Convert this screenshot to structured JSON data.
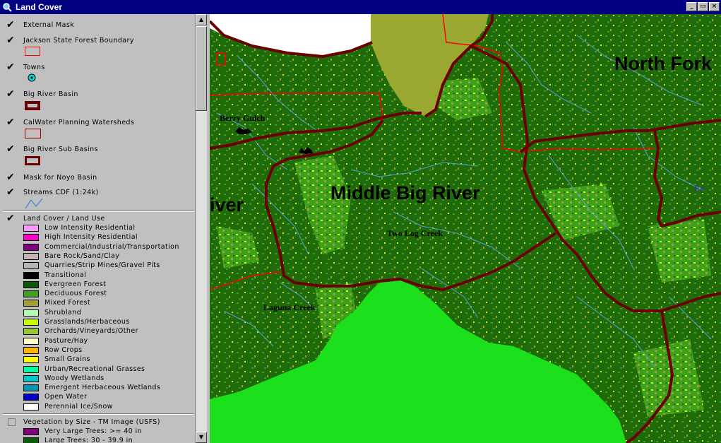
{
  "window": {
    "title": "Land Cover",
    "minimize": "_",
    "restore": "▭",
    "close": "×"
  },
  "toc": {
    "layers": [
      {
        "name": "External Mask",
        "checked": "✔"
      },
      {
        "name": "Jackson State Forest Boundary",
        "checked": "✔"
      },
      {
        "name": "Towns",
        "checked": "✔"
      },
      {
        "name": "Big River Basin",
        "checked": "✔"
      },
      {
        "name": "CalWater Planning Watersheds",
        "checked": "✔"
      },
      {
        "name": "Big River Sub Basins",
        "checked": "✔"
      },
      {
        "name": "Mask for Noyo Basin",
        "checked": "✔"
      },
      {
        "name": "Streams CDF (1:24k)",
        "checked": "✔"
      },
      {
        "name": "Land Cover / Land Use",
        "checked": "✔"
      },
      {
        "name": "Vegetation by Size - TM Image (USFS)",
        "checked": ""
      }
    ],
    "land_cover_legend": [
      {
        "label": "Low Intensity Residential",
        "color": "#ff99ff"
      },
      {
        "label": "High Intensity Residential",
        "color": "#ff00cc"
      },
      {
        "label": "Commercial/Industrial/Transportation",
        "color": "#800080"
      },
      {
        "label": "Bare Rock/Sand/Clay",
        "color": "#c8b4b4"
      },
      {
        "label": "Quarries/Strip Mines/Gravel Pits",
        "color": "#b4b4b4"
      },
      {
        "label": "Transitional",
        "color": "#000000"
      },
      {
        "label": "Evergreen Forest",
        "color": "#0a5a0a"
      },
      {
        "label": "Deciduous Forest",
        "color": "#3ca01e"
      },
      {
        "label": "Mixed Forest",
        "color": "#a0a032"
      },
      {
        "label": "Shrubland",
        "color": "#b4ffb4"
      },
      {
        "label": "Grasslands/Herbaceous",
        "color": "#c8ff00"
      },
      {
        "label": "Orchards/Vineyards/Other",
        "color": "#96c832"
      },
      {
        "label": "Pasture/Hay",
        "color": "#ffffc8"
      },
      {
        "label": "Row Crops",
        "color": "#ffb400"
      },
      {
        "label": "Small Grains",
        "color": "#ffff00"
      },
      {
        "label": "Urban/Recreational Grasses",
        "color": "#00ffa0"
      },
      {
        "label": "Woody Wetlands",
        "color": "#00c8c8"
      },
      {
        "label": "Emergent Herbaceous Wetlands",
        "color": "#0096b4"
      },
      {
        "label": "Open Water",
        "color": "#0000c8"
      },
      {
        "label": "Perennial Ice/Snow",
        "color": "#ffffff"
      }
    ],
    "vegetation_legend": [
      {
        "label": "Very Large Trees: >= 40  in",
        "color": "#800080"
      },
      {
        "label": "Large Trees: 30 - 39.9 in",
        "color": "#0a5a0a"
      }
    ]
  },
  "map": {
    "labels": {
      "north_fork": "North Fork",
      "middle_big_river": "Middle Big River",
      "river_fragment": "iver",
      "berry_gulch": "Berry Gulch",
      "two_log_creek": "Two Log Creek",
      "laguna_creek": "Laguna Creek",
      "east_fragment": "Ea"
    },
    "colors": {
      "evergreen": "#1f6b0b",
      "deciduous": "#3ca01e",
      "mixed": "#a0a032",
      "grassland": "#c8ff00",
      "mask": "#9aa832",
      "bright_mask": "#1de01d",
      "stream": "#5aa0d2",
      "basin_boundary": "#6b0000",
      "watershed_line": "#ff0000"
    }
  }
}
